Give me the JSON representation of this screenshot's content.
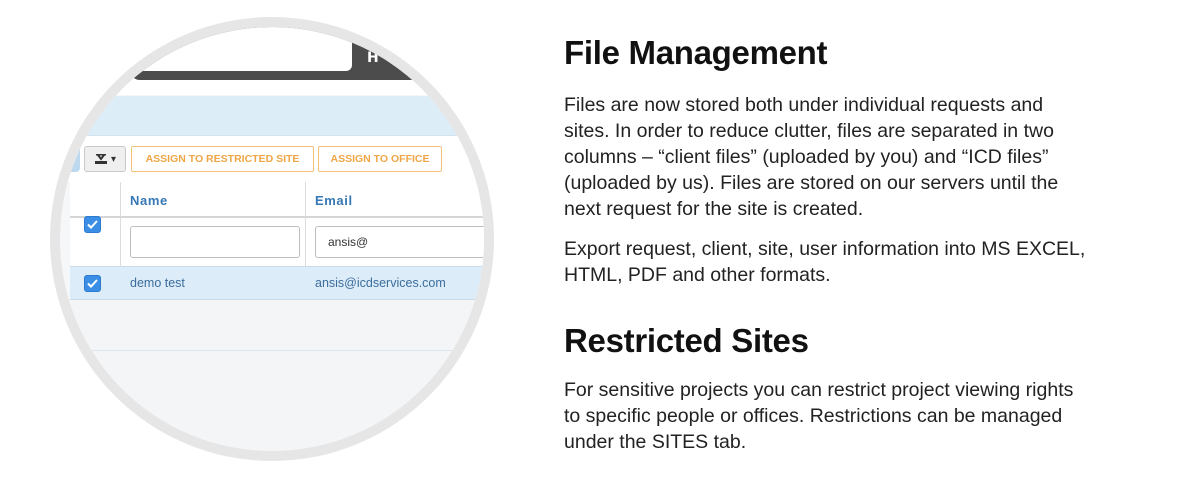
{
  "screenshot": {
    "top_button_text": "H",
    "toolbar": {
      "export_icon": "export-dropdown-icon",
      "export_caret": "▾",
      "assign_restricted_label": "ASSIGN TO RESTRICTED SITE",
      "assign_office_label": "ASSIGN TO OFFICE"
    },
    "table": {
      "columns": [
        "Name",
        "Email"
      ],
      "filters": {
        "name_value": "",
        "email_value": "ansis@"
      },
      "rows": [
        {
          "name": "demo test",
          "email": "ansis@icdservices.com",
          "checked": true
        }
      ],
      "select_all_checked": true
    },
    "colors": {
      "accent_blue": "#3a8ee6",
      "assign_orange": "#f0a646",
      "header_text": "#3677b4",
      "row_highlight": "#dcecf8"
    }
  },
  "content": {
    "file_management": {
      "heading": "File Management",
      "para1": " Files are now stored both under individual requests and\nsites. In order to reduce clutter, files are separated in two\ncolumns – “client files” (uploaded by you) and “ICD files”\n(uploaded by us). Files are stored on our servers until the\nnext request for the site is created.",
      "para2": "Export request, client, site, user information into MS EXCEL,\nHTML, PDF and other formats."
    },
    "restricted_sites": {
      "heading": "Restricted Sites",
      "para": "For sensitive projects you can restrict project viewing rights\nto specific people or offices. Restrictions can be managed\nunder the SITES tab."
    }
  }
}
